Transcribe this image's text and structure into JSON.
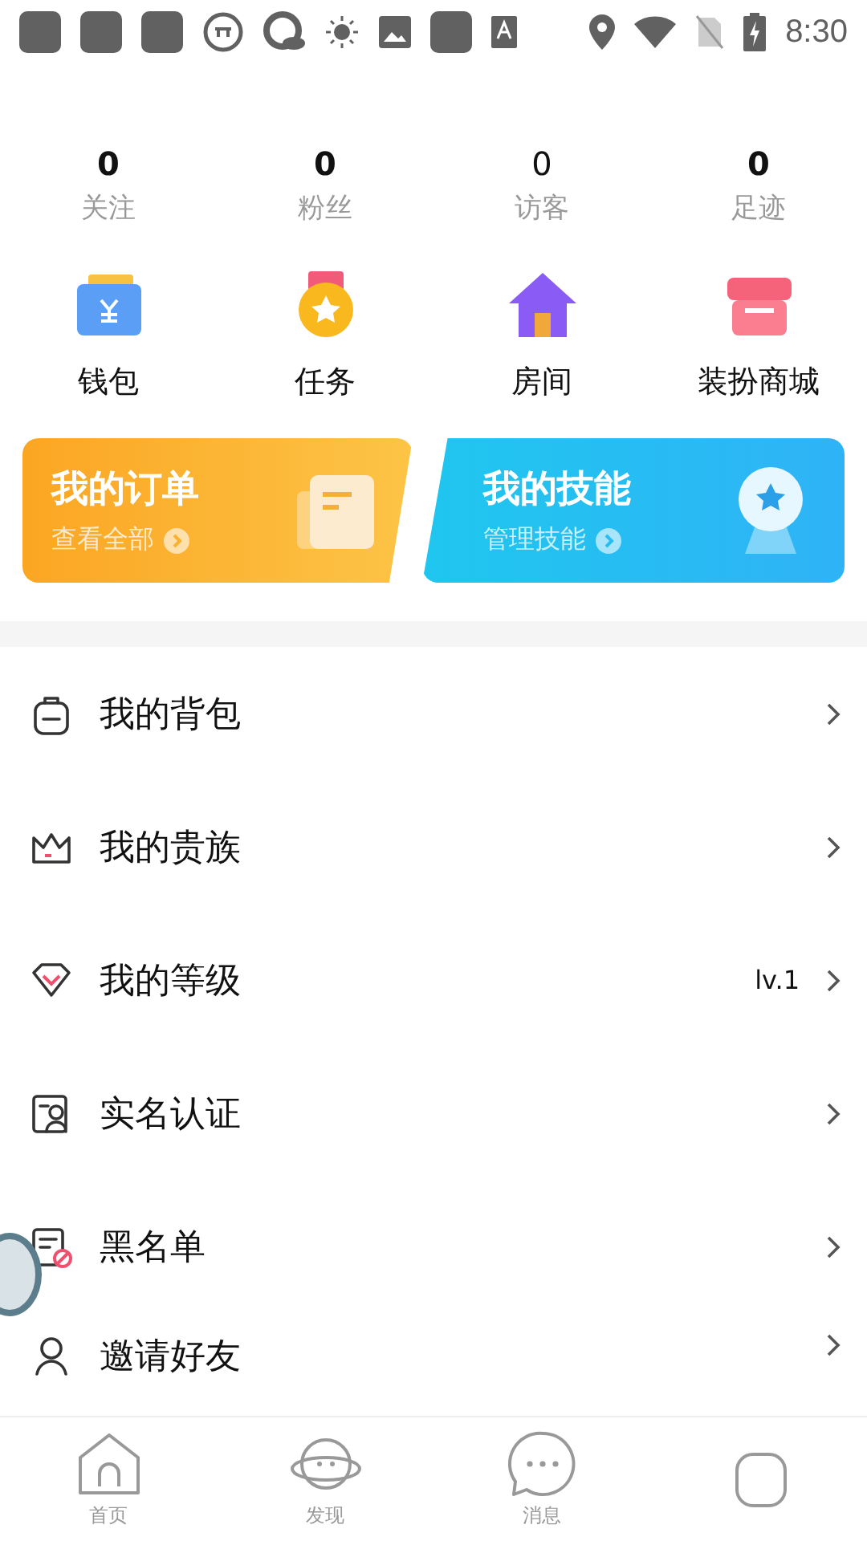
{
  "status_bar": {
    "time": "8:30"
  },
  "stats": [
    {
      "value": "0",
      "label": "关注",
      "bold": true
    },
    {
      "value": "0",
      "label": "粉丝",
      "bold": true
    },
    {
      "value": "0",
      "label": "访客",
      "bold": false
    },
    {
      "value": "0",
      "label": "足迹",
      "bold": true
    }
  ],
  "shortcuts": [
    {
      "kind": "wallet",
      "label": "钱包"
    },
    {
      "kind": "task",
      "label": "任务"
    },
    {
      "kind": "room",
      "label": "房间"
    },
    {
      "kind": "shop",
      "label": "装扮商城"
    }
  ],
  "cards": [
    {
      "kind": "orders",
      "title": "我的订单",
      "link": "查看全部"
    },
    {
      "kind": "skills",
      "title": "我的技能",
      "link": "管理技能"
    }
  ],
  "menu": [
    {
      "kind": "bag",
      "label": "我的背包"
    },
    {
      "kind": "noble",
      "label": "我的贵族"
    },
    {
      "kind": "level",
      "label": "我的等级",
      "value": "lv.1"
    },
    {
      "kind": "realname",
      "label": "实名认证"
    },
    {
      "kind": "blacklist",
      "label": "黑名单"
    },
    {
      "kind": "invite",
      "label": "邀请好友"
    }
  ],
  "tab_bar": [
    {
      "kind": "home",
      "label": "首页"
    },
    {
      "kind": "discover",
      "label": "发现"
    },
    {
      "kind": "message",
      "label": "消息"
    },
    {
      "kind": "me"
    }
  ]
}
